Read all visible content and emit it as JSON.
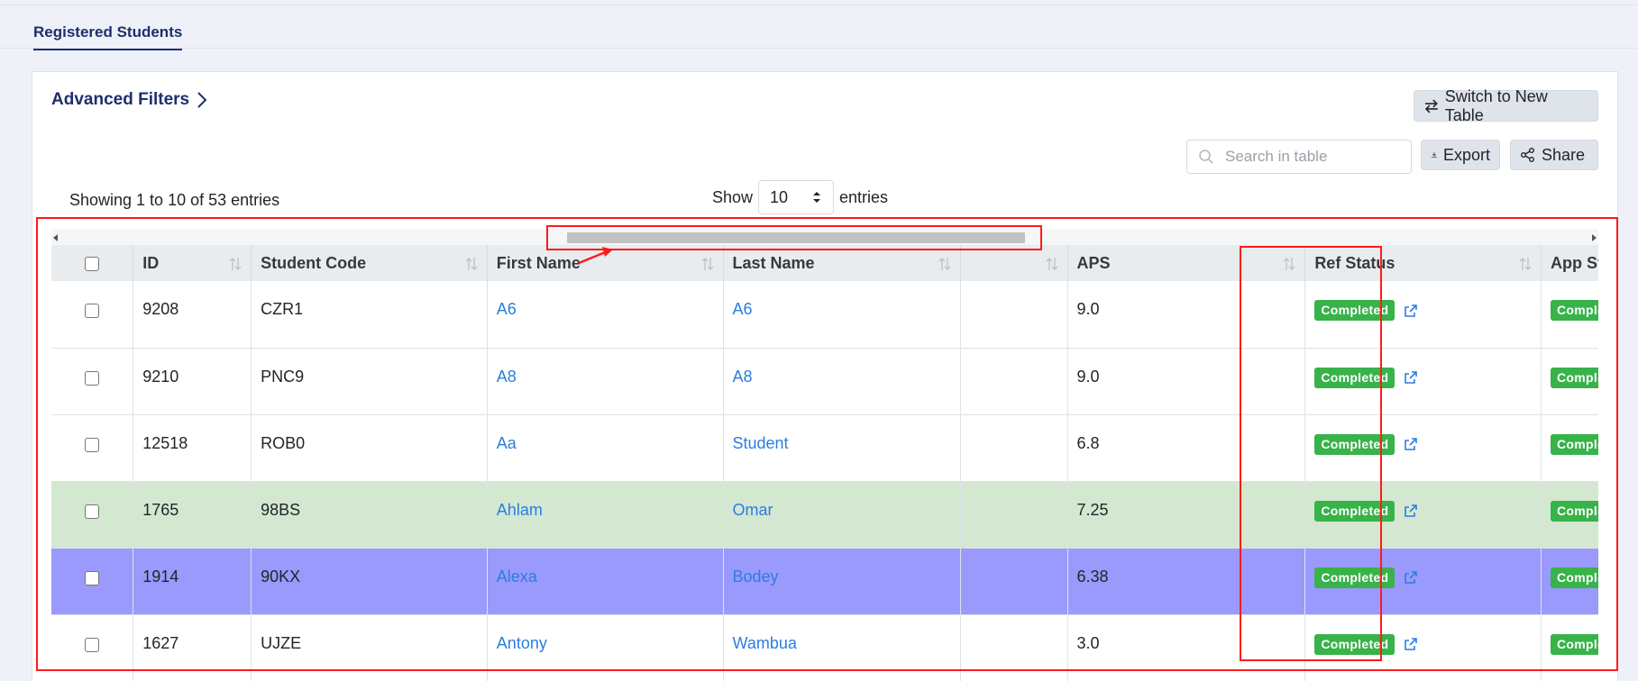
{
  "tabs": {
    "active": "Registered Students"
  },
  "filters": {
    "advanced_label": "Advanced Filters"
  },
  "toolbar": {
    "switch_label": "Switch to New Table",
    "export_label": "Export",
    "share_label": "Share",
    "search_placeholder": "Search in table"
  },
  "info": {
    "showing": "Showing 1 to 10 of 53 entries"
  },
  "length": {
    "show": "Show",
    "value": "10",
    "entries": "entries"
  },
  "table": {
    "headers": {
      "id": "ID",
      "student_code": "Student Code",
      "first_name": "First Name",
      "last_name": "Last Name",
      "blank": "",
      "aps": "APS",
      "ref_status": "Ref Status",
      "app_status": "App Status"
    },
    "rows": [
      {
        "id": "9208",
        "code": "CZR1",
        "first": "A6",
        "last": "A6",
        "aps": "9.0",
        "ref": "Completed",
        "app": "Completed"
      },
      {
        "id": "9210",
        "code": "PNC9",
        "first": "A8",
        "last": "A8",
        "aps": "9.0",
        "ref": "Completed",
        "app": "Completed"
      },
      {
        "id": "12518",
        "code": "ROB0",
        "first": "Aa",
        "last": "Student",
        "aps": "6.8",
        "ref": "Completed",
        "app": "Completed"
      },
      {
        "id": "1765",
        "code": "98BS",
        "first": "Ahlam",
        "last": "Omar",
        "aps": "7.25",
        "ref": "Completed",
        "app": "Completed"
      },
      {
        "id": "1914",
        "code": "90KX",
        "first": "Alexa",
        "last": "Bodey",
        "aps": "6.38",
        "ref": "Completed",
        "app": "Completed"
      },
      {
        "id": "1627",
        "code": "UJZE",
        "first": "Antony",
        "last": "Wambua",
        "aps": "3.0",
        "ref": "Completed",
        "app": "Completed"
      }
    ]
  },
  "colors": {
    "primary": "#1e2f6d",
    "link": "#2b7de0",
    "badge": "#38b34a",
    "highlight_green": "#d4e8d1",
    "highlight_purple": "#9a9afc",
    "annotation": "#ff1a1a"
  }
}
